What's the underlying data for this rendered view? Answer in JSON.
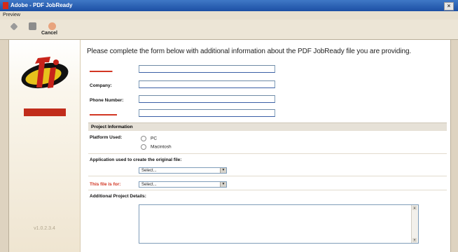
{
  "window": {
    "title": "Adobe - PDF JobReady",
    "close_glyph": "×"
  },
  "menu": {
    "items": [
      "Preview"
    ]
  },
  "toolbar": {
    "buttons": [
      {
        "icon": "back-arrow-icon",
        "label": ""
      },
      {
        "icon": "stop-icon",
        "label": ""
      },
      {
        "icon": "cancel-icon",
        "label": "Cancel"
      }
    ]
  },
  "sidebar": {
    "version": "v1.0.2.3.4"
  },
  "form": {
    "intro": "Please complete the form below with additional information about the PDF JobReady file you are providing.",
    "company_label": "Company:",
    "phone_label": "Phone Number:",
    "section_title": "Project Information",
    "platform_label": "Platform Used:",
    "platform_options": [
      "PC",
      "Macintosh"
    ],
    "application_label": "Application used to create the original file:",
    "application_select": "Select...",
    "file_for_label": "This file is for:",
    "file_for_select": "Select...",
    "details_label": "Additional Project Details:"
  },
  "colors": {
    "accent_red": "#d1321e",
    "title_bar": "#1c4fa4",
    "background": "#ded3c0"
  }
}
